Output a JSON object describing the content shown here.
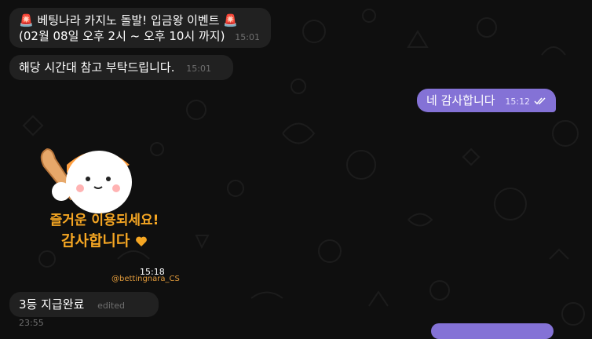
{
  "messages": [
    {
      "line1": "🚨 베팅나라 카지노 돌발! 입금왕 이벤트 🚨",
      "line2": "(02월 08일 오후 2시 ~ 오후 10시 까지)",
      "time": "15:01"
    },
    {
      "text": "해당 시간대 참고 부탁드립니다.",
      "time": "15:01"
    },
    {
      "text": "네 감사합니다",
      "time": "15:12"
    },
    {
      "sticker_line1": "즐거운 이용되세요!",
      "sticker_line2": "감사합니다",
      "sticker_watermark": "@bettingnara_CS",
      "time": "15:18"
    },
    {
      "text": "3등 지급완료",
      "time": "edited 23:55"
    }
  ],
  "colors": {
    "background": "#0f0f0f",
    "incoming_bubble": "#212121",
    "outgoing_bubble": "#8472d6",
    "sticker_text": "#f5a623"
  },
  "icons": [
    "siren-icon",
    "double-check-icon",
    "heart-icon"
  ]
}
